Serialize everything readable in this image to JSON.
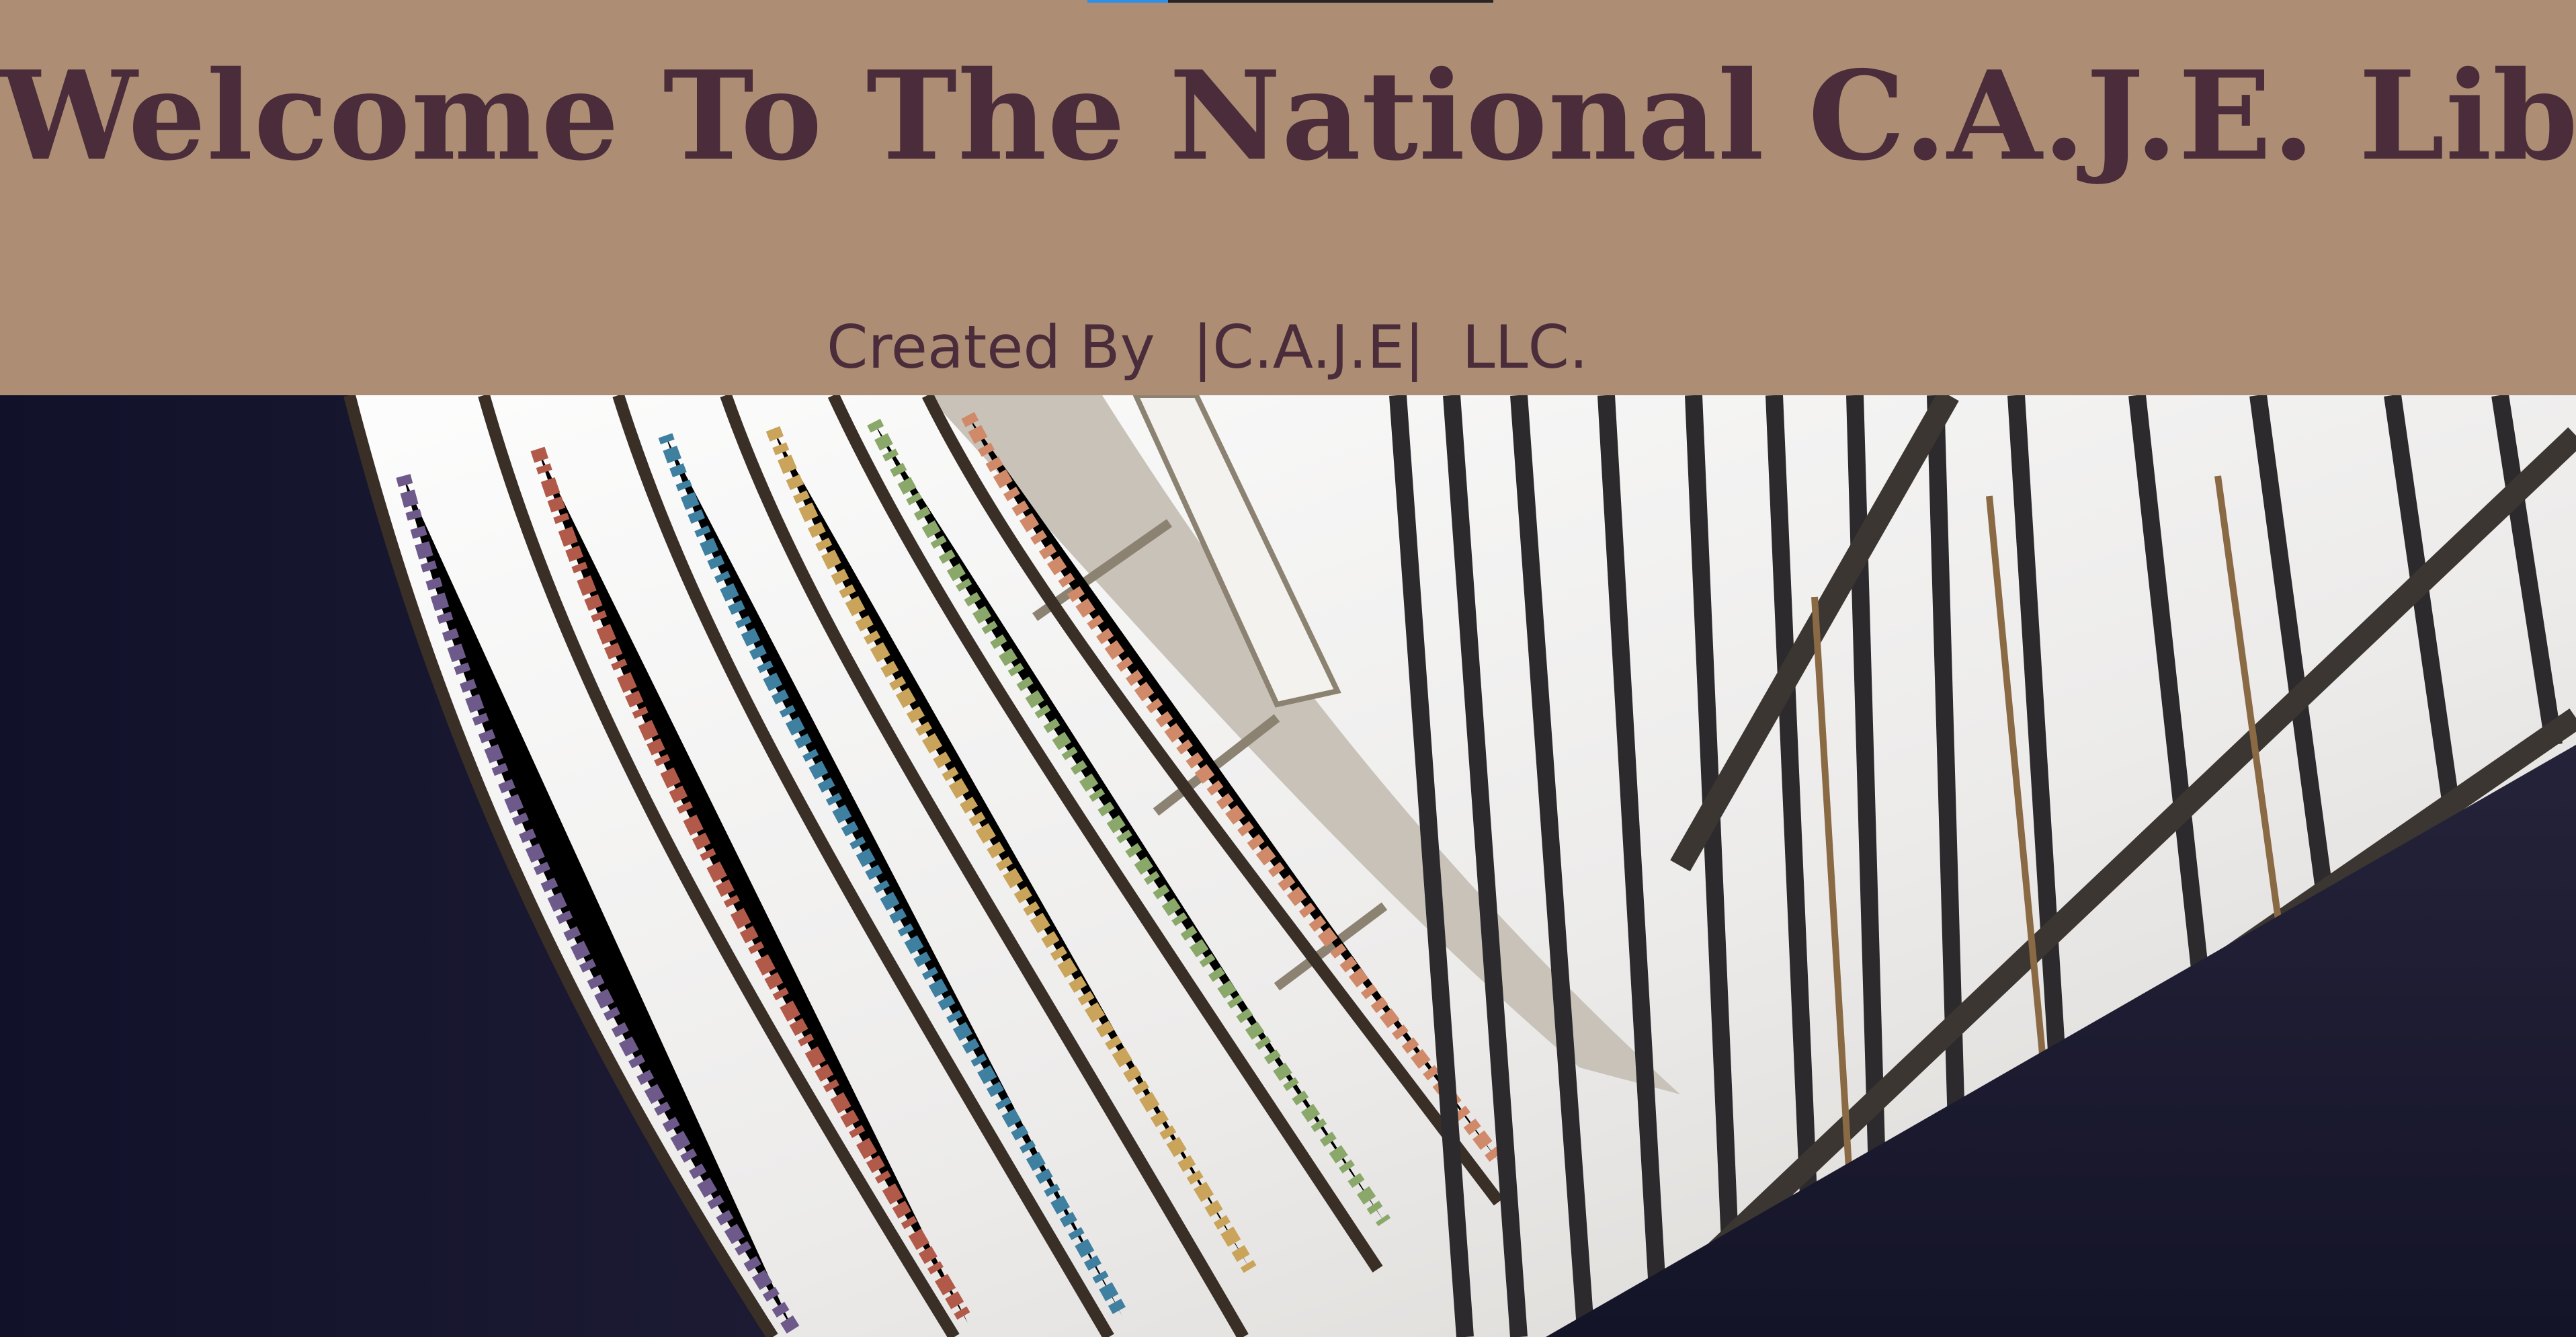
{
  "header": {
    "title": "Welcome To The National C.A.J.E. Library.",
    "subtitle": "Created By  |C.A.J.E|  LLC.",
    "background_color": "#ad8e74",
    "text_color": "#4a2c3a"
  },
  "hero": {
    "image_icon": "library-bookshelves-photo"
  }
}
